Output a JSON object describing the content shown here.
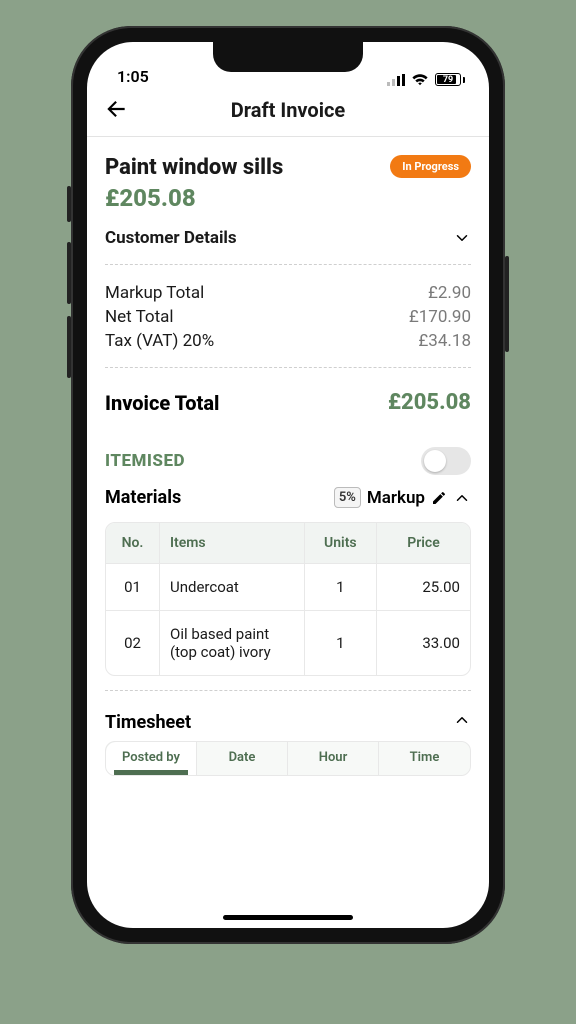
{
  "status_bar": {
    "time": "1:05",
    "battery": "79"
  },
  "header": {
    "title": "Draft Invoice"
  },
  "invoice": {
    "title": "Paint window sills",
    "status": "In Progress",
    "total_display": "£205.08"
  },
  "customer_details_label": "Customer Details",
  "totals": {
    "rows": [
      {
        "label": "Markup Total",
        "value": "£2.90"
      },
      {
        "label": "Net Total",
        "value": "£170.90"
      },
      {
        "label": "Tax (VAT) 20%",
        "value": "£34.18"
      }
    ],
    "grand_label": "Invoice Total",
    "grand_value": "£205.08"
  },
  "itemised": {
    "label": "ITEMISED",
    "enabled": false
  },
  "materials": {
    "label": "Materials",
    "markup_pct": "5%",
    "markup_label": "Markup",
    "headers": {
      "no": "No.",
      "items": "Items",
      "units": "Units",
      "price": "Price"
    },
    "rows": [
      {
        "no": "01",
        "item": "Undercoat",
        "units": "1",
        "price": "25.00"
      },
      {
        "no": "02",
        "item": "Oil based paint (top coat) ivory",
        "units": "1",
        "price": "33.00"
      }
    ]
  },
  "timesheet": {
    "label": "Timesheet",
    "tabs": [
      "Posted by",
      "Date",
      "Hour",
      "Time"
    ]
  }
}
